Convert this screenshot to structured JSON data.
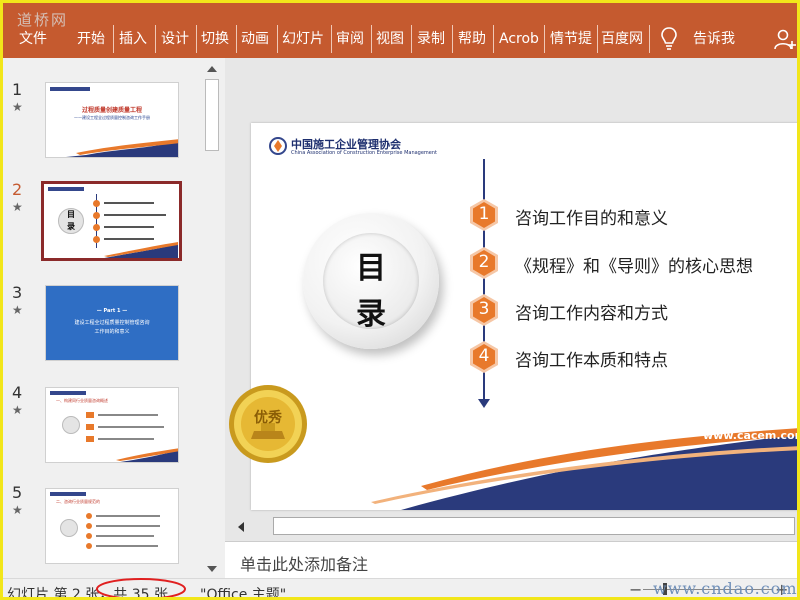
{
  "watermarks": {
    "top": "道桥网",
    "bottom": "www.cndao.com"
  },
  "ribbon": {
    "tabs": [
      "文件",
      "开始",
      "插入",
      "设计",
      "切换",
      "动画",
      "幻灯片",
      "审阅",
      "视图",
      "录制",
      "帮助",
      "Acrob",
      "情节提",
      "百度网"
    ],
    "tellme": "告诉我"
  },
  "thumbnails": [
    {
      "number": "1",
      "star": "★",
      "title": "过程质量创建质量工程",
      "subtitle": "——建设工程全过程质量控制咨询工作手册"
    },
    {
      "number": "2",
      "star": "★",
      "center": "目",
      "center2": "录"
    },
    {
      "number": "3",
      "star": "★",
      "part": "— Part 1 —",
      "line1": "建设工程全过程质量控制管理咨询",
      "line2": "工作目的和意义"
    },
    {
      "number": "4",
      "star": "★",
      "heading": "一、构建同行业质量咨询概述"
    },
    {
      "number": "5",
      "star": "★",
      "heading": "二、咨询行业质量规范的"
    }
  ],
  "slide": {
    "org_name": "中国施工企业管理协会",
    "org_en": "China Association of Construction Enterprise Management",
    "title_char1": "目",
    "title_char2": "录",
    "items": [
      {
        "num": "1",
        "text": "咨询工作目的和意义"
      },
      {
        "num": "2",
        "text": "《规程》和《导则》的核心思想"
      },
      {
        "num": "3",
        "text": "咨询工作内容和方式"
      },
      {
        "num": "4",
        "text": "咨询工作本质和特点"
      }
    ],
    "website": "www.cacem.com",
    "badge_text": "优秀",
    "colors": {
      "orange": "#e8792b",
      "navy": "#2a3a7c",
      "accent": "#c55a2f"
    }
  },
  "notes": {
    "placeholder": "单击此处添加备注"
  },
  "status": {
    "slide_info": "幻灯片 第 2 张，共 35 张",
    "theme": "\"Office 主题\""
  }
}
